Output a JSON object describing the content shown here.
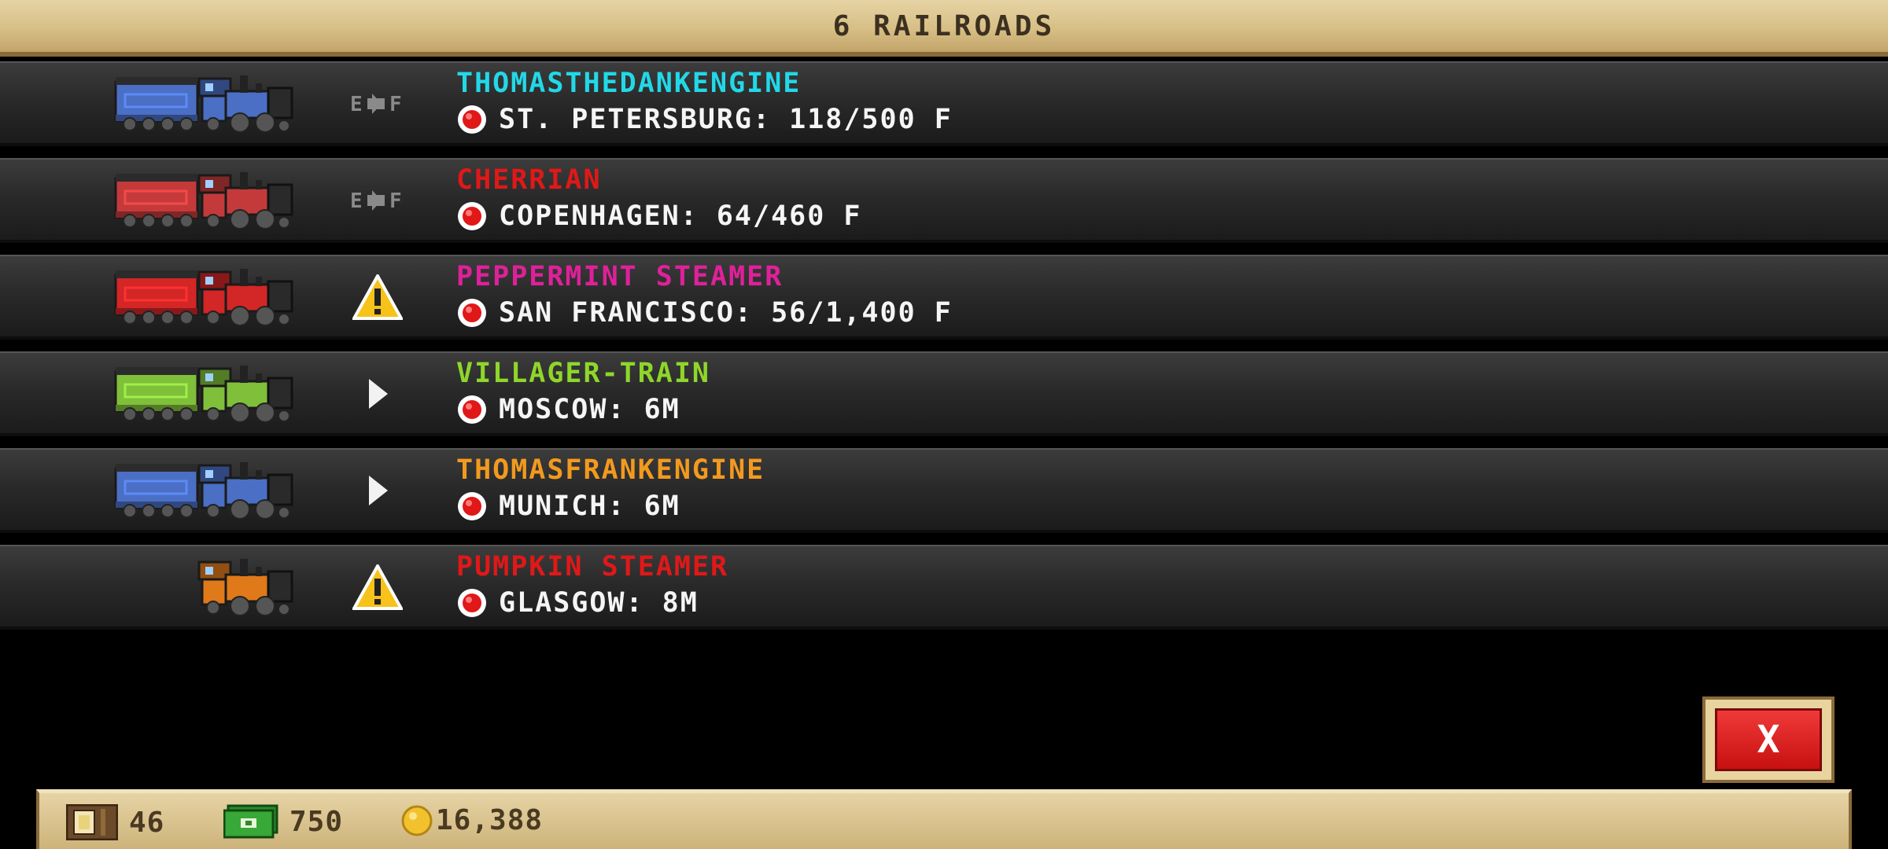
{
  "header": {
    "title": "6 RAILROADS"
  },
  "railroads": [
    {
      "name": "THOMASTHEDANKENGINE",
      "name_color": "#22d8e8",
      "destination": "ST. PETERSBURG: 118/500 F",
      "status_icon": "empty-full-icon",
      "train_color": "#4a6fc4",
      "has_tender": true
    },
    {
      "name": "CHERRIAN",
      "name_color": "#e01818",
      "destination": "COPENHAGEN: 64/460 F",
      "status_icon": "empty-full-icon",
      "train_color": "#c43a3a",
      "has_tender": true
    },
    {
      "name": "PEPPERMINT STEAMER",
      "name_color": "#e0209a",
      "destination": "SAN FRANCISCO: 56/1,400 F",
      "status_icon": "warning-icon",
      "train_color": "#d32626",
      "has_tender": true
    },
    {
      "name": "VILLAGER-TRAIN",
      "name_color": "#8fd62a",
      "destination": "MOSCOW: 6M",
      "status_icon": "play-icon",
      "train_color": "#7fbf3a",
      "has_tender": true
    },
    {
      "name": "THOMASFRANKENGINE",
      "name_color": "#f29a1e",
      "destination": "MUNICH: 6M",
      "status_icon": "play-icon",
      "train_color": "#4a6fc4",
      "has_tender": true
    },
    {
      "name": "PUMPKIN STEAMER",
      "name_color": "#e01818",
      "destination": "GLASGOW: 8M",
      "status_icon": "warning-icon",
      "train_color": "#e0791a",
      "has_tender": false
    }
  ],
  "bottom_bar": {
    "crates": "46",
    "cash": "750",
    "coins": "16,388"
  },
  "close_button": {
    "icon": "close-icon",
    "label": "X"
  }
}
